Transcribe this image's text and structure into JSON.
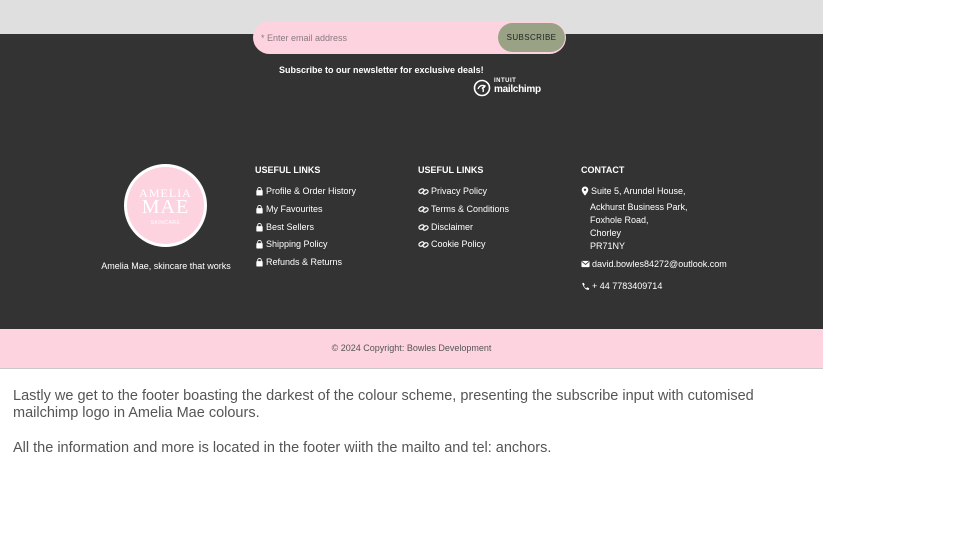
{
  "subscribe": {
    "placeholder": "* Enter email address",
    "button_label": "SUBSCRIBE",
    "newsletter_text": "Subscribe to our newsletter for exclusive deals!",
    "mailchimp_intuit": "INTUIT",
    "mailchimp_word": "mailchimp"
  },
  "brand": {
    "logo_line1": "AMELIA",
    "logo_line2": "MAE",
    "logo_line3": "SKINCARE",
    "tagline": "Amelia Mae, skincare that works"
  },
  "useful_links_1": {
    "title": "USEFUL LINKS",
    "items": [
      {
        "label": "Profile & Order History",
        "icon": "shopping-bag-icon"
      },
      {
        "label": "My Favourites",
        "icon": "shopping-bag-icon"
      },
      {
        "label": "Best Sellers",
        "icon": "shopping-bag-icon"
      },
      {
        "label": "Shipping Policy",
        "icon": "shopping-bag-icon"
      },
      {
        "label": "Refunds & Returns",
        "icon": "shopping-bag-icon"
      }
    ]
  },
  "useful_links_2": {
    "title": "USEFUL LINKS",
    "items": [
      {
        "label": "Privacy Policy",
        "icon": "link-icon"
      },
      {
        "label": "Terms & Conditions",
        "icon": "link-icon"
      },
      {
        "label": "Disclaimer",
        "icon": "link-icon"
      },
      {
        "label": "Cookie Policy",
        "icon": "link-icon"
      }
    ]
  },
  "contact": {
    "title": "CONTACT",
    "address_lines": [
      "Suite 5, Arundel House,",
      "Ackhurst Business Park,",
      "Foxhole Road,",
      "Chorley",
      "PR71NY"
    ],
    "email": "david.bowles84272@outlook.com",
    "phone": "+ 44 7783409714"
  },
  "copyright": "© 2024 Copyright: Bowles Development",
  "caption": {
    "paragraph1": "Lastly we get to the footer boasting the darkest of the colour scheme, presenting the subscribe input with cutomised mailchimp logo in Amelia Mae colours.",
    "paragraph2": "All the information and more is located in the footer wiith the mailto and tel: anchors."
  },
  "colors": {
    "footer_dark": "#333333",
    "brand_pink": "#fdd3e0",
    "button_sage": "#9aa286",
    "top_grey": "#dfdfdf"
  }
}
